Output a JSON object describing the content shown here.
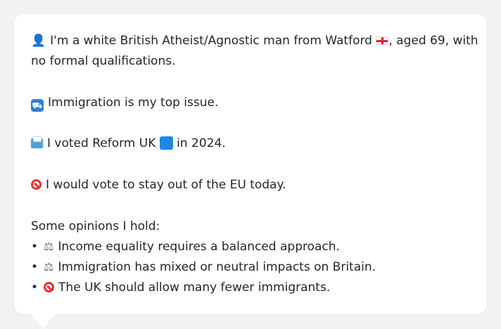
{
  "profile": {
    "line1_part1": "I'm a white British Atheist/Agnostic man from Watford",
    "line1_part2": ", aged 69, with",
    "line1_cont": "no formal qualifications.",
    "immigration_text": "Immigration is my top issue.",
    "vote_part1": "I voted Reform UK",
    "vote_part2": "in 2024.",
    "eu_text": "I would vote to stay out of the EU today."
  },
  "opinions": {
    "heading": "Some opinions I hold:",
    "items": [
      {
        "bullet": "•",
        "icon": "balance-scale-icon",
        "text": "Income equality requires a balanced approach."
      },
      {
        "bullet": "•",
        "icon": "balance-scale-icon",
        "text": "Immigration has mixed or neutral impacts on Britain."
      },
      {
        "bullet": "•",
        "icon": "no-entry-icon",
        "text": "The UK should allow many fewer immigrants."
      }
    ]
  },
  "icons": {
    "person": "bust-in-silhouette-icon",
    "flag": "england-flag-icon",
    "passport": "passport-control-icon",
    "ballot": "ballot-box-icon",
    "party_color": "blue-square-icon",
    "eu": "no-entry-icon"
  },
  "colors": {
    "background": "#f2f2f4",
    "card": "#ffffff",
    "text": "#262626",
    "no_entry_red": "#e33131",
    "reform_blue": "#1e88e5"
  }
}
